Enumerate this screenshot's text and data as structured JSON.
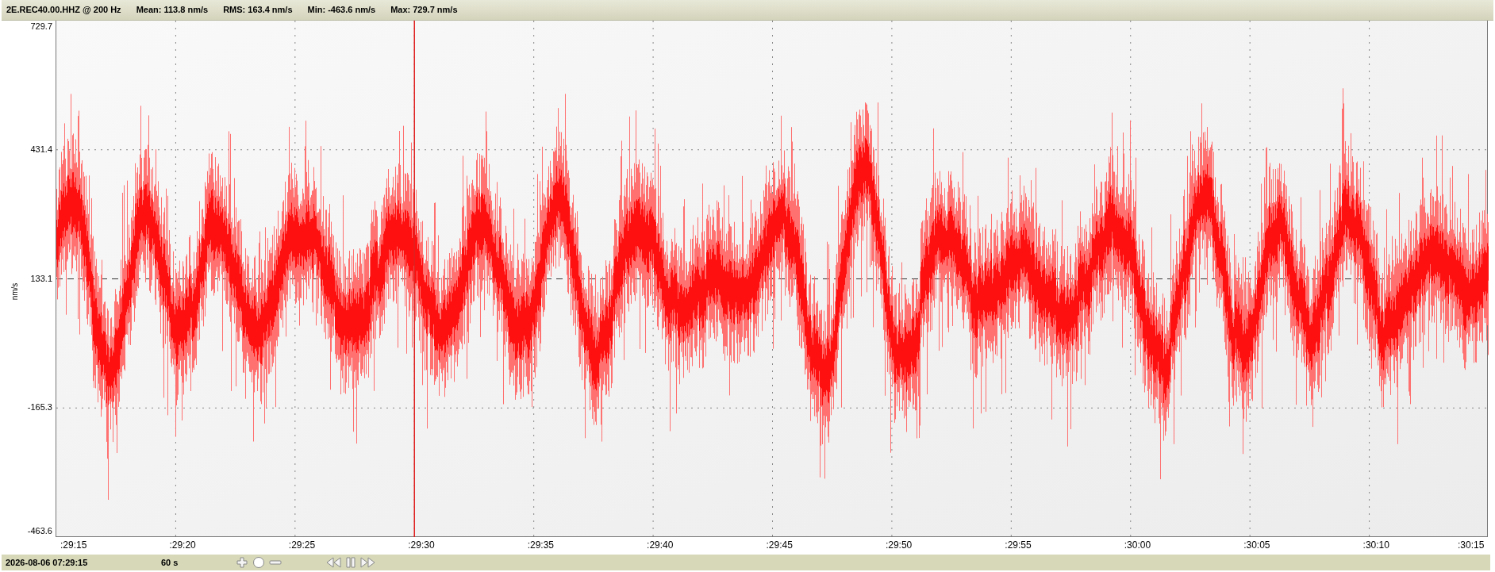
{
  "header": {
    "channel": "2E.REC40.00.HHZ @ 200 Hz",
    "stats": [
      "Mean: 113.8 nm/s",
      "RMS: 163.4 nm/s",
      "Min: -463.6 nm/s",
      "Max: 729.7 nm/s"
    ]
  },
  "plot": {
    "y_unit": "nm/s",
    "y_labels": [
      {
        "text": "729.7",
        "kind": "edge"
      },
      {
        "text": "431.4",
        "kind": "grid"
      },
      {
        "text": "133.1",
        "kind": "mean"
      },
      {
        "text": "-165.3",
        "kind": "grid"
      },
      {
        "text": "-463.6",
        "kind": "edge"
      }
    ],
    "x_labels": [
      ":29:15",
      ":29:20",
      ":29:25",
      ":29:30",
      ":29:35",
      ":29:40",
      ":29:45",
      ":29:50",
      ":29:55",
      ":30:00",
      ":30:05",
      ":30:10",
      ":30:15"
    ]
  },
  "footer": {
    "start_time": "2026-08-06 07:29:15",
    "window": "60 s"
  }
}
